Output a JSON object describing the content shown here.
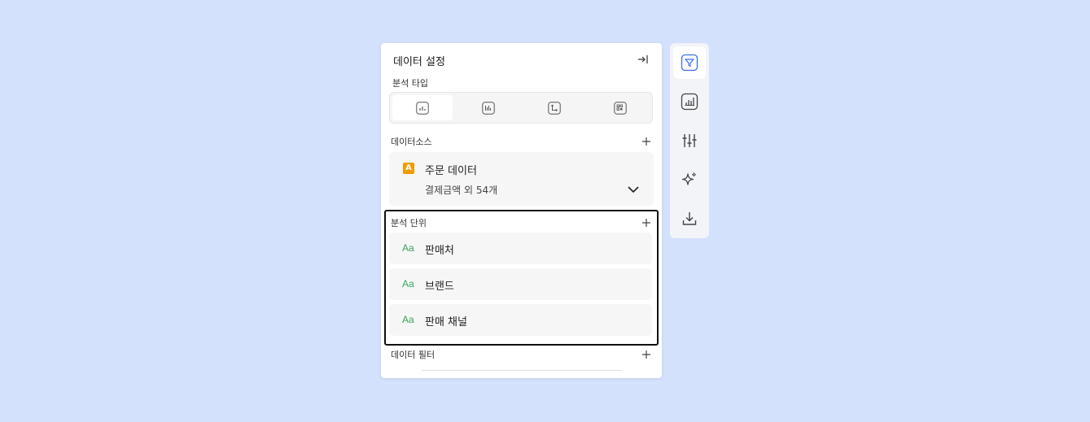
{
  "panel": {
    "title": "데이터 설정",
    "analysis_type": {
      "label": "분석 타입",
      "options": [
        "bar-chart-icon",
        "column-chart-icon",
        "flow-chart-icon",
        "grid-chart-icon"
      ],
      "selected_index": 0
    },
    "data_source": {
      "label": "데이터소스",
      "source_badge": "A",
      "source_name": "주문 데이터",
      "source_fields": "결제금액 외 54개"
    },
    "analysis_unit": {
      "label": "분석 단위",
      "items": [
        {
          "icon_text": "Aa",
          "label": "판매처"
        },
        {
          "icon_text": "Aa",
          "label": "브랜드"
        },
        {
          "icon_text": "Aa",
          "label": "판매 채널"
        }
      ]
    },
    "data_filter": {
      "label": "데이터 필터"
    }
  },
  "toolbar": {
    "items": [
      "filter-icon",
      "chart-icon",
      "sliders-icon",
      "sparkle-icon",
      "download-icon"
    ],
    "active_index": 0
  },
  "colors": {
    "background": "#d3e1fd",
    "accent": "#3b6df6",
    "badge": "#f29a00",
    "text_type_icon": "#3aa35c"
  }
}
